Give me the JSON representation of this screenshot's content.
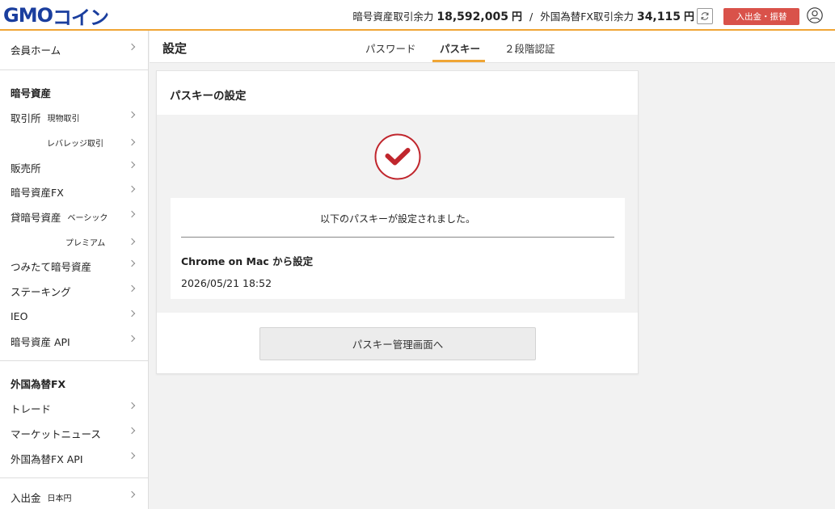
{
  "header": {
    "logo_main": "GMO",
    "logo_sub": "コイン",
    "crypto_balance_label": "暗号資産取引余力",
    "crypto_balance_value": "18,592,005",
    "crypto_balance_unit": "円",
    "separator": "/",
    "fx_balance_label": "外国為替FX取引余力",
    "fx_balance_value": "34,115",
    "fx_balance_unit": "円",
    "refresh_icon": "refresh-icon",
    "deposit_label": "入出金・振替",
    "user_icon": "user-icon",
    "accent_color": "#f0a535",
    "deposit_color": "#d9524a"
  },
  "sidebar": {
    "home": "会員ホーム",
    "section_crypto": "暗号資産",
    "exchange": "取引所",
    "exchange_spot": "現物取引",
    "exchange_leverage": "レバレッジ取引",
    "sales": "販売所",
    "crypto_fx": "暗号資産FX",
    "lending": "貸暗号資産",
    "lending_basic": "ベーシック",
    "lending_premium": "プレミアム",
    "tsumitate": "つみたて暗号資産",
    "staking": "ステーキング",
    "ieo": "IEO",
    "crypto_api": "暗号資産 API",
    "section_fx": "外国為替FX",
    "trade": "トレード",
    "market_news": "マーケットニュース",
    "fx_api": "外国為替FX API",
    "deposit": "入出金",
    "deposit_jpy": "日本円"
  },
  "content": {
    "title": "設定",
    "tabs": [
      "パスワード",
      "パスキー",
      "２段階認証"
    ],
    "active_tab": "パスキー"
  },
  "panel": {
    "title": "パスキーの設定",
    "success_icon": "check-circle-icon",
    "success_color": "#c0262d",
    "message": "以下のパスキーが設定されました。",
    "passkey_name": "Chrome on Mac から設定",
    "passkey_date": "2026/05/21 18:52",
    "manage_button": "パスキー管理画面へ"
  }
}
